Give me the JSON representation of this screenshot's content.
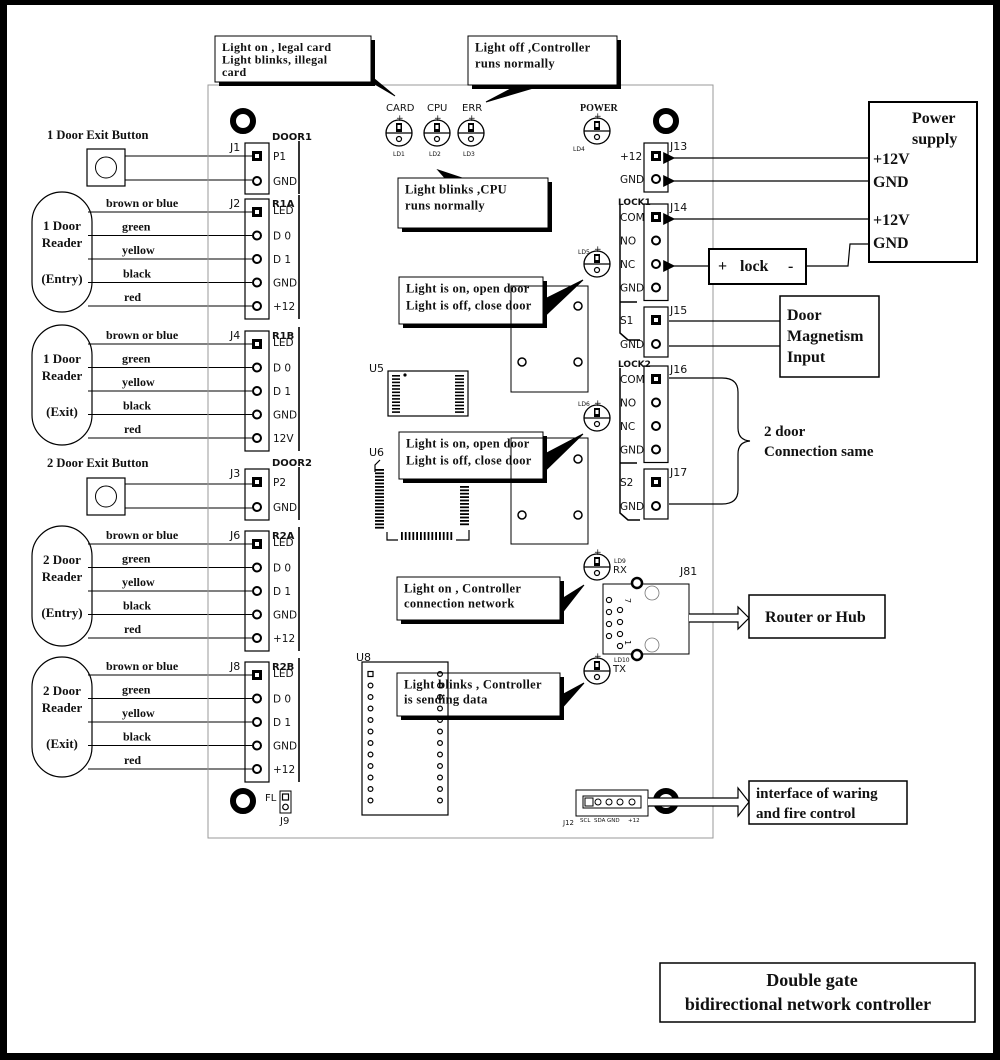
{
  "title": {
    "line1": "Double gate",
    "line2": "bidirectional network controller"
  },
  "callouts": {
    "card": [
      "Light on , legal card",
      "Light blinks, illegal",
      "card"
    ],
    "err": [
      "Light off ,Controller",
      "runs normally"
    ],
    "cpu": [
      "Light blinks ,CPU",
      "runs normally"
    ],
    "lock1_led": [
      "Light is on, open door",
      "Light is off, close door"
    ],
    "lock2_led": [
      "Light is on, open door",
      "Light is off, close door"
    ],
    "rx": [
      "Light on , Controller",
      "connection network"
    ],
    "tx": [
      "Light blinks , Controller",
      "is sending data"
    ]
  },
  "leds": {
    "card": {
      "label": "CARD",
      "ref": "LD1"
    },
    "cpu": {
      "label": "CPU",
      "ref": "LD2"
    },
    "err": {
      "label": "ERR",
      "ref": "LD3"
    },
    "power": {
      "label": "POWER",
      "ref": "LD4"
    },
    "ld5": {
      "ref": "LD5"
    },
    "ld6": {
      "ref": "LD6"
    },
    "rx": {
      "label": "RX",
      "ref": "LD9"
    },
    "tx": {
      "label": "TX",
      "ref": "LD10"
    }
  },
  "left_devices": {
    "exit1": {
      "label": "1 Door Exit Button"
    },
    "exit2": {
      "label": "2 Door Exit Button"
    },
    "readers": [
      {
        "lines": [
          "1 Door",
          "Reader",
          "(Entry)"
        ]
      },
      {
        "lines": [
          "1 Door",
          "Reader",
          "(Exit)"
        ]
      },
      {
        "lines": [
          "2 Door",
          "Reader",
          "(Entry)"
        ]
      },
      {
        "lines": [
          "2 Door",
          "Reader",
          "(Exit)"
        ]
      }
    ],
    "wire_colors": [
      "brown or blue",
      "green",
      "yellow",
      "black",
      "red"
    ]
  },
  "connectors_left": [
    {
      "ref": "J1",
      "group": "DOOR1",
      "pins": [
        "P1",
        "GND"
      ]
    },
    {
      "ref": "J2",
      "group": "R1A",
      "pins": [
        "LED",
        "D 0",
        "D 1",
        "GND",
        "+12"
      ]
    },
    {
      "ref": "J4",
      "group": "R1B",
      "pins": [
        "LED",
        "D 0",
        "D 1",
        "GND",
        "12V"
      ]
    },
    {
      "ref": "J3",
      "group": "DOOR2",
      "pins": [
        "P2",
        "GND"
      ]
    },
    {
      "ref": "J6",
      "group": "R2A",
      "pins": [
        "LED",
        "D 0",
        "D 1",
        "GND",
        "+12"
      ]
    },
    {
      "ref": "J8",
      "group": "R2B",
      "pins": [
        "LED",
        "D 0",
        "D 1",
        "GND",
        "+12"
      ]
    }
  ],
  "connectors_right": [
    {
      "ref": "J13",
      "group": "",
      "pins": [
        "+12",
        "GND"
      ]
    },
    {
      "ref": "J14",
      "group": "LOCK1",
      "pins": [
        "COM",
        "NO",
        "NC",
        "GND"
      ]
    },
    {
      "ref": "J15",
      "group": "",
      "pins": [
        "S1",
        "GND"
      ]
    },
    {
      "ref": "J16",
      "group": "LOCK2",
      "pins": [
        "COM",
        "NO",
        "NC",
        "GND"
      ]
    },
    {
      "ref": "J17",
      "group": "",
      "pins": [
        "S2",
        "GND"
      ]
    }
  ],
  "chips": {
    "u5": "U5",
    "u6": "U6",
    "u8": "U8"
  },
  "j9": {
    "ref": "J9",
    "label": "FL"
  },
  "j81": {
    "ref": "J81",
    "pin_hi": "7",
    "pin_lo": "1"
  },
  "j12": {
    "ref": "J12",
    "pins": [
      "SCL",
      "SDA",
      "GND",
      "+12"
    ]
  },
  "power_supply": {
    "title": [
      "Power",
      "supply"
    ],
    "terms": [
      "+12V",
      "GND",
      "+12V",
      "GND"
    ]
  },
  "lock_box": {
    "plus": "+",
    "label": "lock",
    "minus": "-"
  },
  "door_magnetism": [
    "Door",
    "Magnetism",
    "Input"
  ],
  "two_door": [
    "2 door",
    "Connection same"
  ],
  "router": "Router or Hub",
  "fire": [
    "interface of waring",
    "and fire control"
  ]
}
